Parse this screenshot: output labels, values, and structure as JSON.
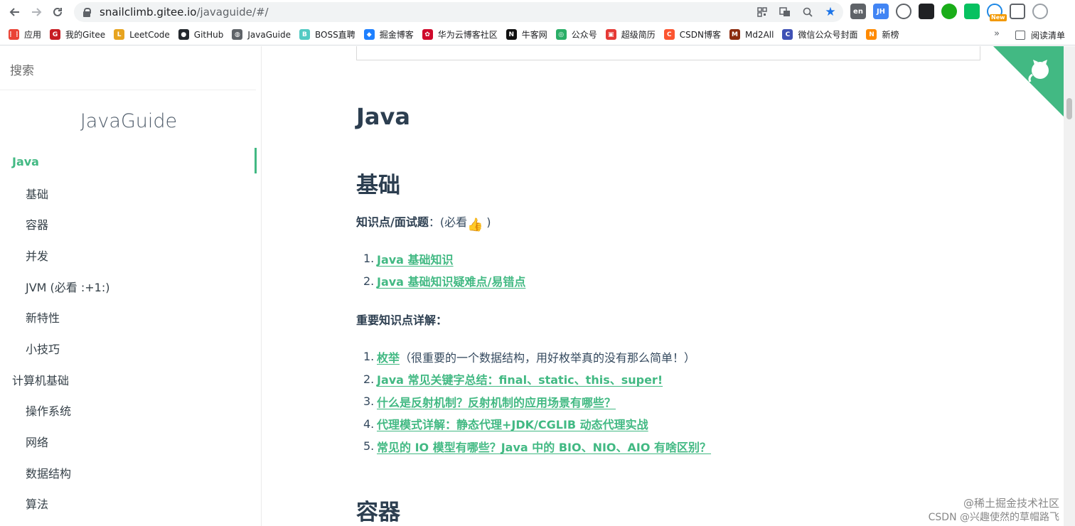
{
  "browser": {
    "url_host": "snailclimb.gitee.io",
    "url_path": "/javaguide/#/",
    "extensions": [
      {
        "name": "lingoes-icon",
        "label": "en",
        "color": "#5f6368"
      },
      {
        "name": "jh-icon",
        "label": "JH",
        "color": "#4285f4"
      },
      {
        "name": "eye-icon",
        "label": "",
        "color": "#5f6368"
      },
      {
        "name": "tampermonkey-icon",
        "label": "",
        "color": "#202124"
      },
      {
        "name": "check-circle-icon",
        "label": "",
        "color": "#1aad19"
      },
      {
        "name": "chat-icon",
        "label": "",
        "color": "#07c160"
      },
      {
        "name": "cloud-icon",
        "label": "",
        "color": "#1e88e5",
        "badge": "New"
      },
      {
        "name": "puzzle-icon",
        "label": "",
        "color": "#5f6368"
      },
      {
        "name": "profile-icon",
        "label": "",
        "color": "#9aa0a6"
      }
    ],
    "bookmarks": [
      {
        "name": "apps",
        "label": "应用",
        "color": "#ea4335",
        "glyph": "⋮⋮"
      },
      {
        "name": "gitee",
        "label": "我的Gitee",
        "color": "#c71d23",
        "glyph": "G"
      },
      {
        "name": "leetcode",
        "label": "LeetCode",
        "color": "#e7a41f",
        "glyph": "L"
      },
      {
        "name": "github",
        "label": "GitHub",
        "color": "#24292e",
        "glyph": "●"
      },
      {
        "name": "javaguide",
        "label": "JavaGuide",
        "color": "#5f6368",
        "glyph": "◍"
      },
      {
        "name": "boss",
        "label": "BOSS直聘",
        "color": "#53cac3",
        "glyph": "B"
      },
      {
        "name": "juejin",
        "label": "掘金博客",
        "color": "#1e80ff",
        "glyph": "◆"
      },
      {
        "name": "huawei",
        "label": "华为云博客社区",
        "color": "#cf0a2c",
        "glyph": "✿"
      },
      {
        "name": "nowcoder",
        "label": "牛客网",
        "color": "#111111",
        "glyph": "N"
      },
      {
        "name": "wechat-mp",
        "label": "公众号",
        "color": "#2aae67",
        "glyph": "◎"
      },
      {
        "name": "resume",
        "label": "超级简历",
        "color": "#e53935",
        "glyph": "▣"
      },
      {
        "name": "csdn",
        "label": "CSDN博客",
        "color": "#fc5531",
        "glyph": "C"
      },
      {
        "name": "md2all",
        "label": "Md2All",
        "color": "#8b2b0e",
        "glyph": "M"
      },
      {
        "name": "wx-cover",
        "label": "微信公众号封面",
        "color": "#3f51b5",
        "glyph": "C"
      },
      {
        "name": "xinbang",
        "label": "新榜",
        "color": "#ff8a00",
        "glyph": "N"
      }
    ],
    "more": "»",
    "reading_list": "阅读清单"
  },
  "sidebar": {
    "search_placeholder": "搜索",
    "app_name": "JavaGuide",
    "items": [
      {
        "label": "Java",
        "level": "top",
        "active": true
      },
      {
        "label": "基础",
        "level": "sub"
      },
      {
        "label": "容器",
        "level": "sub"
      },
      {
        "label": "并发",
        "level": "sub"
      },
      {
        "label": "JVM (必看 :+1:)",
        "level": "sub"
      },
      {
        "label": "新特性",
        "level": "sub"
      },
      {
        "label": "小技巧",
        "level": "sub"
      },
      {
        "label": "计算机基础",
        "level": "top"
      },
      {
        "label": "操作系统",
        "level": "sub"
      },
      {
        "label": "网络",
        "level": "sub"
      },
      {
        "label": "数据结构",
        "level": "sub"
      },
      {
        "label": "算法",
        "level": "sub"
      }
    ]
  },
  "content": {
    "h1": "Java",
    "section_basic": "基础",
    "knowledge_label": "知识点/面试题",
    "knowledge_suffix": "：(必看",
    "knowledge_end": ")",
    "list1": [
      {
        "num": "1.",
        "text": "Java 基础知识"
      },
      {
        "num": "2.",
        "text": "Java 基础知识疑难点/易错点"
      }
    ],
    "important_label": "重要知识点详解：",
    "list2": [
      {
        "num": "1.",
        "text": "枚举",
        "tail": "  （很重要的一个数据结构，用好枚举真的没有那么简单！）"
      },
      {
        "num": "2.",
        "text": "Java 常见关键字总结：final、static、this、super!"
      },
      {
        "num": "3.",
        "text": "什么是反射机制？反射机制的应用场景有哪些？"
      },
      {
        "num": "4.",
        "text": "代理模式详解：静态代理+JDK/CGLIB 动态代理实战"
      },
      {
        "num": "5.",
        "text": "常见的 IO 模型有哪些？Java 中的 BIO、NIO、AIO 有啥区别？"
      }
    ],
    "section_container": "容器"
  },
  "watermark": {
    "line1": "@稀土掘金技术社区",
    "line2": "CSDN @兴趣使然的草帽路飞"
  },
  "colors": {
    "accent": "#42b983",
    "heading": "#2c3e50",
    "text": "#34495e"
  }
}
